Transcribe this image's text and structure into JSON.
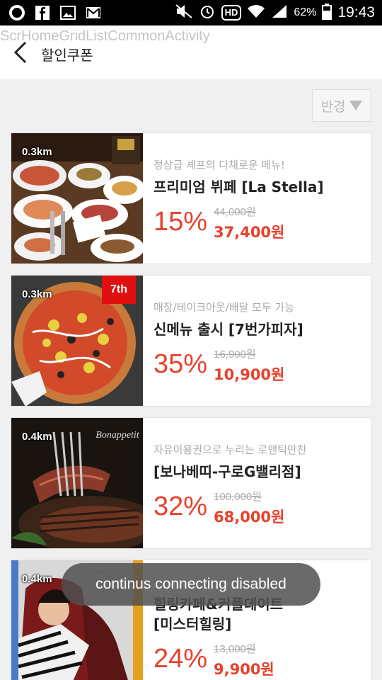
{
  "status": {
    "battery": "62%",
    "time": "19:43",
    "hd": "HD",
    "left_icons": [
      "opera-icon",
      "facebook-icon",
      "gallery-icon",
      "gmail-icon"
    ],
    "right_icons": [
      "mute-icon",
      "alarm-icon",
      "hd-icon",
      "wifi-icon",
      "signal-icon",
      "battery-icon"
    ]
  },
  "header": {
    "activity": "ScrHomeGridListCommonActivity",
    "title": "할인쿠폰"
  },
  "filter": {
    "label": "반경"
  },
  "coupons": [
    {
      "distance": "0.3km",
      "subtitle": "정상급 셰프의 다채로운 메뉴!",
      "name": "프리미엄 뷔페 [La Stella]",
      "discount": "15%",
      "original": "44,000원",
      "price": "37,400원"
    },
    {
      "distance": "0.3km",
      "subtitle": "매장/테이크아웃/배달 모두 가능",
      "name": "신메뉴 출시 [7번가피자]",
      "discount": "35%",
      "original": "16,900원",
      "price": "10,900원"
    },
    {
      "distance": "0.4km",
      "subtitle": "자유이용권으로 누리는 로맨틱만찬",
      "name": "[보나베띠-구로G밸리점]",
      "discount": "32%",
      "original": "100,000원",
      "price": "68,000원"
    },
    {
      "distance": "0.4km",
      "subtitle": "",
      "name": "힐링카페&커플데이트",
      "name2": "[미스터힐링]",
      "discount": "24%",
      "original": "13,000원",
      "price": "9,900원"
    }
  ],
  "toast": "continus connecting disabled",
  "colors": {
    "accent": "#e8412c",
    "background": "#f0f0f0"
  }
}
